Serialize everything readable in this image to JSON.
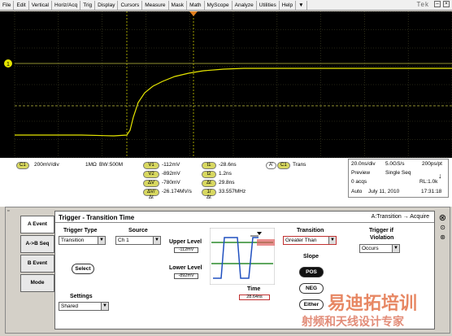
{
  "menu": {
    "items": [
      "File",
      "Edit",
      "Vertical",
      "Horiz/Acq",
      "Trig",
      "Display",
      "Cursors",
      "Measure",
      "Mask",
      "Math",
      "MyScope",
      "Analyze",
      "Utilities",
      "Help"
    ],
    "brand": "Tek"
  },
  "scope": {
    "channel_marker": "1",
    "trace_color": "#e6e600",
    "grid_color": "#4a4a2a"
  },
  "readouts": {
    "ch1_badge": "C1",
    "ch1_scale": "200mV/div",
    "ch1_impedance": "1MΩ",
    "ch1_bw_symbol": "BW",
    "ch1_bw": ":500M",
    "cursors": [
      {
        "badge": "V1",
        "value": "-112mV"
      },
      {
        "badge": "V2",
        "value": "-892mV"
      },
      {
        "badge": "ΔV",
        "value": "-780mV"
      },
      {
        "badge": "ΔV/Δt",
        "value": "-26.174MV/s"
      }
    ],
    "times": [
      {
        "badge": "t1",
        "value": "-28.6ns"
      },
      {
        "badge": "t2",
        "value": "1.2ns"
      },
      {
        "badge": "Δt",
        "value": "29.8ns"
      },
      {
        "badge": "1/Δt",
        "value": "33.557MHz"
      }
    ],
    "trigger_badge_a": "A'",
    "trigger_badge_c": "C1",
    "trigger_type": "Trans",
    "acq": {
      "timebase": "20.0ns/div",
      "sample_rate": "5.0GS/s",
      "resolution": "200ps/pt",
      "mode": "Preview",
      "seq": "Single Seq",
      "acqs": "0 acqs",
      "record": "RL:1.0k",
      "auto": "Auto",
      "date": "July 11, 2010",
      "time": "17:31:18"
    }
  },
  "panel": {
    "tabs": [
      "A Event",
      "A->B Seq",
      "B Event",
      "Mode"
    ],
    "title": "Trigger - Transition Time",
    "breadcrumb": "A:Transition → Acquire",
    "trigger_type_label": "Trigger Type",
    "trigger_type_value": "Transition",
    "source_label": "Source",
    "source_value": "Ch 1",
    "select_button": "Select",
    "settings_label": "Settings",
    "settings_value": "Shared",
    "upper_level_label": "Upper Level",
    "upper_level_value": "-112mV",
    "lower_level_label": "Lower Level",
    "lower_level_value": "-892mV",
    "time_label": "Time",
    "time_value": "28.64ns",
    "transition_label": "Transition",
    "transition_value": "Greater Than",
    "slope_label": "Slope",
    "slope_pos": "POS",
    "slope_neg": "NEG",
    "slope_either": "Either",
    "violation_label_1": "Trigger if",
    "violation_label_2": "Violation",
    "violation_value": "Occurs",
    "close_glyph": "⊗"
  },
  "watermark": {
    "line1": "易迪拓培训",
    "line2": "射频和天线设计专家"
  }
}
